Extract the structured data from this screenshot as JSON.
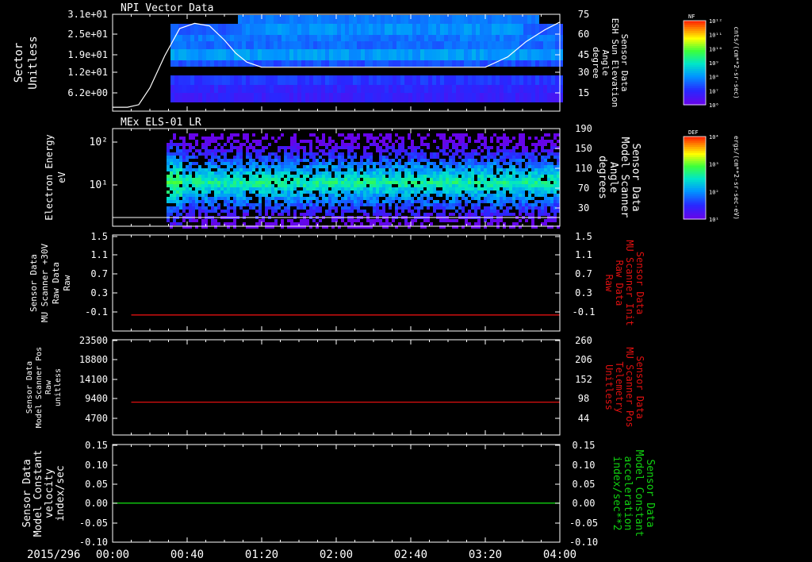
{
  "chart_data": [
    {
      "type": "heatmap",
      "title": "NPI Vector Data",
      "ylabel_left": [
        "Sector",
        "Unitless"
      ],
      "left_ticks": [
        "3.1e+01",
        "2.5e+01",
        "1.9e+01",
        "1.2e+01",
        "6.2e+00"
      ],
      "ylabel_right": [
        "Sensor Data",
        "ESH Sun Elevation",
        "Angle",
        "degree"
      ],
      "right_ticks": [
        "75",
        "60",
        "45",
        "30",
        "15"
      ],
      "ylim_right": [
        0,
        75
      ],
      "overlay_line_degrees": {
        "x_minutes": [
          0,
          8,
          14,
          20,
          28,
          36,
          44,
          52,
          60,
          66,
          72,
          80,
          200,
          212,
          222,
          232,
          240
        ],
        "y": [
          3,
          3,
          5,
          18,
          43,
          64,
          68,
          66,
          55,
          45,
          38,
          34,
          34,
          42,
          54,
          63,
          69
        ]
      },
      "colorbar": {
        "label": "NF",
        "unit": "cnts/(cm**2-sr-sec)",
        "ticks": [
          "10¹²",
          "10¹¹",
          "10¹⁰",
          "10⁹",
          "10⁸",
          "10⁷",
          "10⁶"
        ]
      }
    },
    {
      "type": "heatmap",
      "title": "MEx ELS-01 LR",
      "ylabel_left": [
        "Electron Energy",
        "eV"
      ],
      "left_ticks": [
        "10²",
        "10¹"
      ],
      "ylabel_right": [
        "Sensor Data",
        "Model Scanner",
        "Angle",
        "degrees"
      ],
      "right_ticks": [
        "190",
        "150",
        "110",
        "70",
        "30"
      ],
      "colorbar": {
        "label": "DEF",
        "unit": "ergs/(cm**2-sr-sec-eV)",
        "ticks": [
          "10⁴",
          "10³",
          "10²",
          "10¹"
        ]
      }
    },
    {
      "type": "line",
      "ylabel_left": [
        "Sensor Data",
        "MU Scanner +30V",
        "Raw Data",
        "Raw"
      ],
      "left_ticks": [
        "1.5",
        "1.1",
        "0.7",
        "0.3",
        "-0.1"
      ],
      "ylim": [
        -0.3,
        1.5
      ],
      "ylabel_right": [
        "Sensor Data",
        "MU Scanner Init",
        "Raw Data",
        "Raw"
      ],
      "right_ticks": [
        "1.5",
        "1.1",
        "0.7",
        "0.3",
        "-0.1"
      ],
      "series": [
        {
          "color": "#e01010",
          "x_minutes": [
            10,
            240
          ],
          "values": [
            0,
            0
          ]
        }
      ]
    },
    {
      "type": "line",
      "ylabel_left": [
        "Sensor Data",
        "Model Scanner Pos",
        "Raw",
        "unitless"
      ],
      "left_ticks": [
        "23500",
        "18800",
        "14100",
        "9400",
        "4700"
      ],
      "ylim": [
        0,
        23500
      ],
      "ylabel_right": [
        "Sensor Data",
        "MU Scanner Pos",
        "Telemetry",
        "Unitless"
      ],
      "right_ticks": [
        "260",
        "206",
        "152",
        "98",
        "44"
      ],
      "series": [
        {
          "color": "#e01010",
          "x_minutes": [
            10,
            240
          ],
          "values": [
            8100,
            8100
          ]
        }
      ]
    },
    {
      "type": "line",
      "ylabel_left": [
        "Sensor Data",
        "Model Constant",
        "velocity",
        "index/sec"
      ],
      "left_ticks": [
        "0.15",
        "0.10",
        "0.05",
        "0.00",
        "-0.05",
        "-0.10"
      ],
      "ylim": [
        -0.1,
        0.15
      ],
      "ylabel_right": [
        "Sensor Data",
        "Model Constant",
        "acceleration",
        "index/sec**2"
      ],
      "right_ticks": [
        "0.15",
        "0.10",
        "0.05",
        "0.00",
        "-0.05",
        "-0.10"
      ],
      "series": [
        {
          "color": "#10d010",
          "x_minutes": [
            0,
            240
          ],
          "values": [
            0,
            0
          ]
        }
      ]
    }
  ],
  "x_axis": {
    "date_label": "2015/296",
    "tick_labels": [
      "00:00",
      "00:40",
      "01:20",
      "02:00",
      "02:40",
      "03:20",
      "04:00"
    ],
    "xlim_minutes": [
      0,
      240
    ]
  },
  "colors": {
    "axis": "#ffffff",
    "red_label": "#e01010",
    "green_label": "#10d010"
  }
}
